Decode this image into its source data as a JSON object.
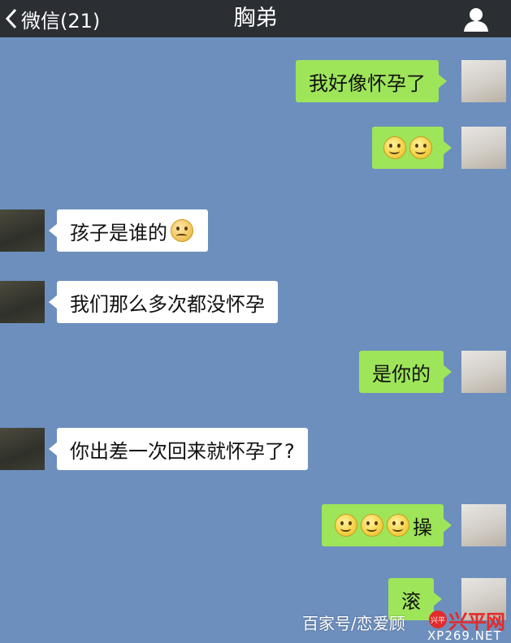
{
  "header": {
    "back_label": "微信(21)",
    "title": "胸弟",
    "back_icon": "chevron-left-icon",
    "profile_icon": "person-icon"
  },
  "messages": [
    {
      "side": "right",
      "text": "我好像怀孕了"
    },
    {
      "side": "right",
      "text": "",
      "emojis": 2
    },
    {
      "side": "left",
      "text": "孩子是谁的"
    },
    {
      "side": "left",
      "text": "我们那么多次都没怀孕"
    },
    {
      "side": "right",
      "text": "是你的"
    },
    {
      "side": "left",
      "text": "你出差一次回来就怀孕了?"
    },
    {
      "side": "right",
      "text": "操"
    },
    {
      "side": "right",
      "text": "滚"
    }
  ],
  "watermark": {
    "source": "百家号/恋爱顾",
    "brand": "兴平网",
    "logo_text": "兴平",
    "url": "XP269.NET"
  },
  "colors": {
    "background": "#6d8fbd",
    "header": "#2b2e33",
    "bubble_out": "#9ee55a",
    "bubble_in": "#ffffff"
  }
}
